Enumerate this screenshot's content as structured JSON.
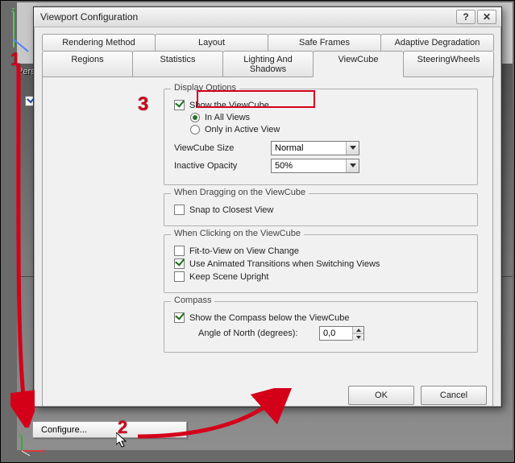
{
  "viewport_label": "Perspective",
  "dialog": {
    "title": "Viewport Configuration",
    "tabs_row1": [
      "Rendering Method",
      "Layout",
      "Safe Frames",
      "Adaptive Degradation"
    ],
    "tabs_row2": [
      "Regions",
      "Statistics",
      "Lighting And Shadows",
      "ViewCube",
      "SteeringWheels"
    ],
    "display_options": {
      "legend": "Display Options",
      "show_viewcube": "Show the ViewCube",
      "in_all_views": "In All Views",
      "only_active": "Only in Active View",
      "size_label": "ViewCube Size",
      "size_value": "Normal",
      "opacity_label": "Inactive Opacity",
      "opacity_value": "50%"
    },
    "dragging": {
      "legend": "When Dragging on the ViewCube",
      "snap": "Snap to Closest View"
    },
    "clicking": {
      "legend": "When Clicking on the ViewCube",
      "fit": "Fit-to-View on View Change",
      "anim": "Use Animated Transitions when Switching Views",
      "upright": "Keep Scene Upright"
    },
    "compass": {
      "legend": "Compass",
      "show": "Show the Compass below the ViewCube",
      "angle_label": "Angle of North (degrees):",
      "angle_value": "0,0"
    },
    "ok": "OK",
    "cancel": "Cancel"
  },
  "context_button": "Configure...",
  "ann": {
    "one": "1",
    "two": "2",
    "three": "3"
  }
}
